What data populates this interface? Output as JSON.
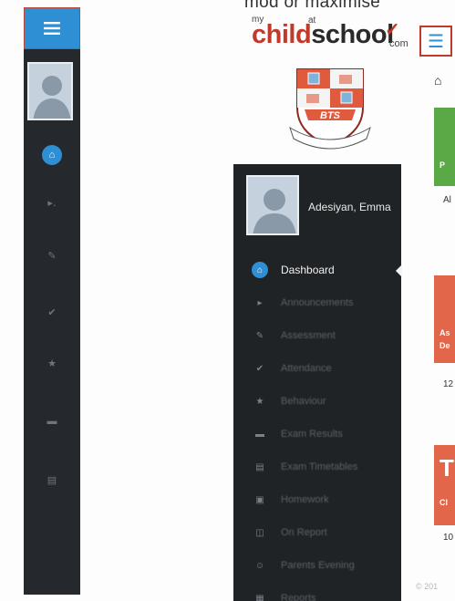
{
  "top_text": "mod or maximise",
  "logo": {
    "my": "my",
    "at": "at",
    "child": "ch",
    "ild": "ild",
    "school": "school",
    "com": "com"
  },
  "crest": {
    "banner": "BTS"
  },
  "profile": {
    "name": "Adesiyan, Emma"
  },
  "nav": [
    {
      "label": "Dashboard",
      "icon": "home-icon",
      "active": true
    },
    {
      "label": "Announcements",
      "icon": "bullhorn-icon"
    },
    {
      "label": "Assessment",
      "icon": "pencil-icon"
    },
    {
      "label": "Attendance",
      "icon": "check-icon"
    },
    {
      "label": "Behaviour",
      "icon": "thumbs-icon"
    },
    {
      "label": "Exam Results",
      "icon": "mortarboard-icon"
    },
    {
      "label": "Exam Timetables",
      "icon": "calendar-icon"
    },
    {
      "label": "Homework",
      "icon": "folder-icon"
    },
    {
      "label": "On Report",
      "icon": "document-icon"
    },
    {
      "label": "Parents Evening",
      "icon": "people-icon"
    },
    {
      "label": "Reports",
      "icon": "report-icon"
    }
  ],
  "cards": {
    "green_title": "P",
    "green_sub": "Al",
    "red_title_1": "As",
    "red_title_2": "De",
    "red_sub": "12",
    "red2_title_big": "T",
    "red2_title": "Cl",
    "red2_sub": "10"
  },
  "corner_mark": "© 201",
  "colors": {
    "accent": "#2f8fd4",
    "sidebar": "#202326",
    "brand_red": "#c0392b",
    "card_green": "#5aa946",
    "card_red": "#e2674a"
  }
}
